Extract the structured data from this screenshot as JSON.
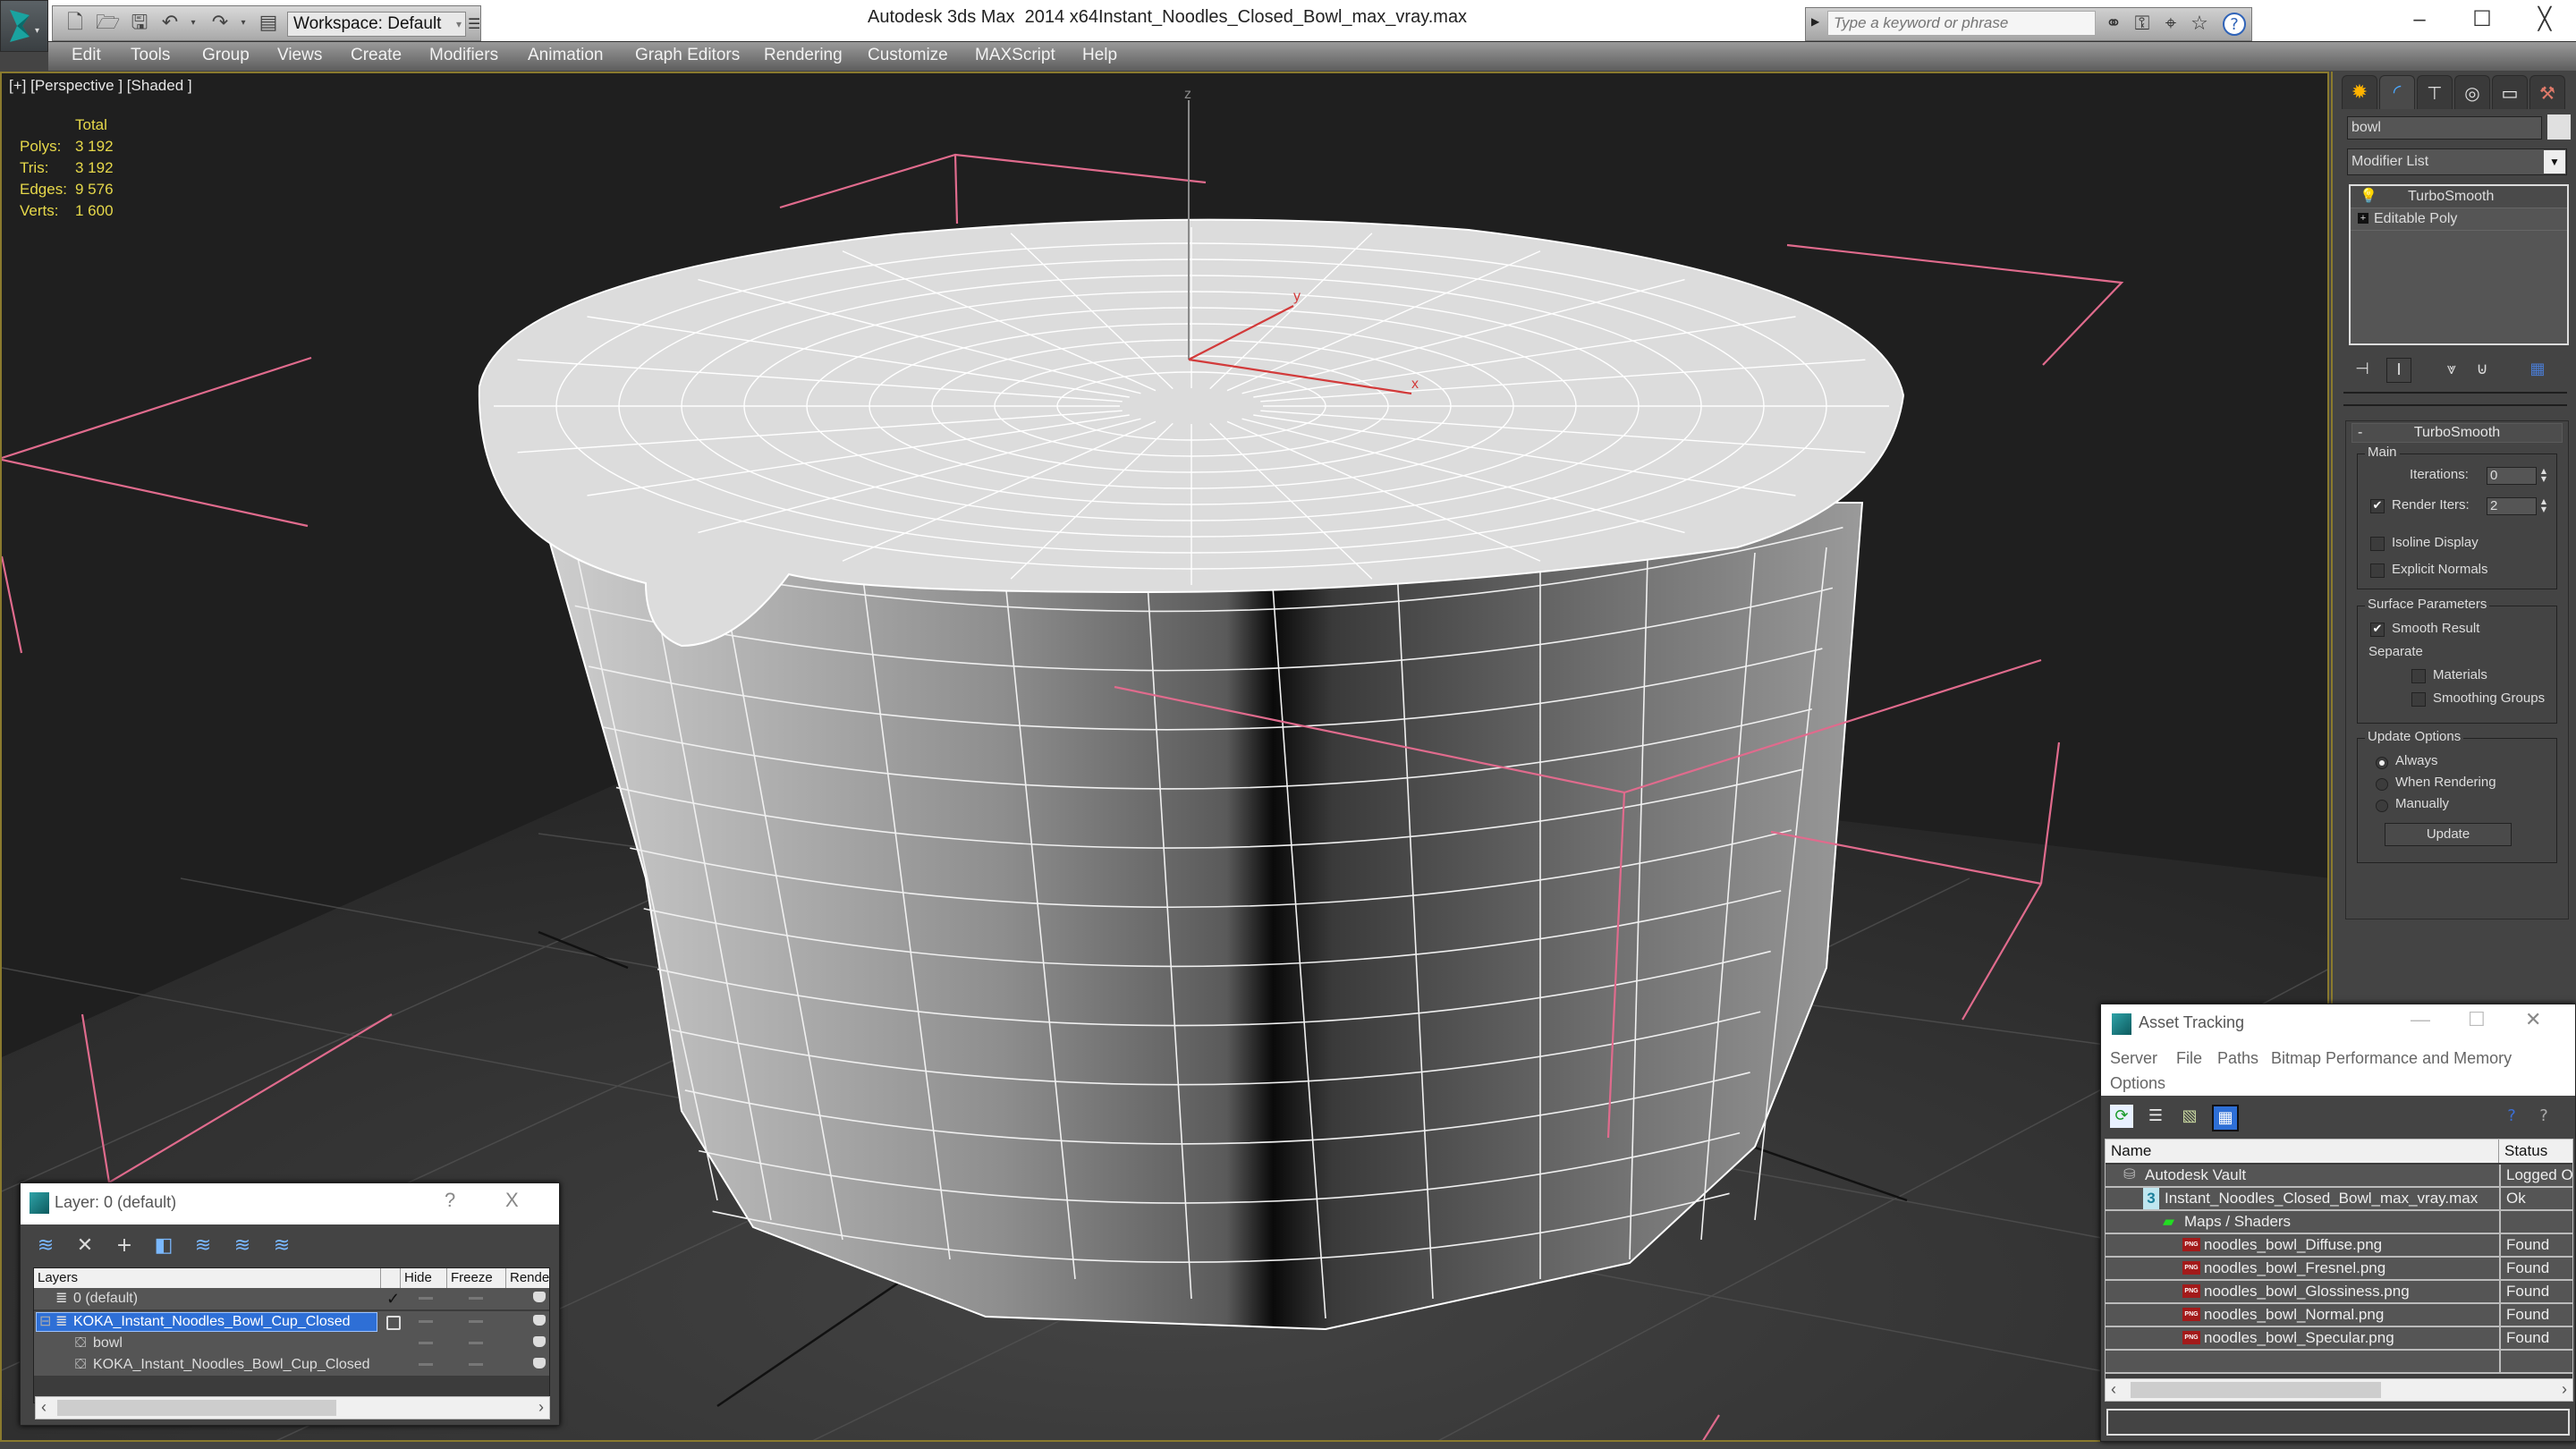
{
  "app": {
    "title": "Autodesk 3ds Max  2014 x64",
    "file_name": "Instant_Noodles_Closed_Bowl_max_vray.max",
    "workspace": "Workspace: Default",
    "search_placeholder": "Type a keyword or phrase",
    "window_controls": [
      "minimize",
      "maximize",
      "close"
    ]
  },
  "quick_access": [
    "new-file-icon",
    "open-file-icon",
    "save-icon",
    "undo-icon",
    "redo-icon",
    "project-folder-icon"
  ],
  "infocenter_icons": [
    "binoculars-icon",
    "key-icon",
    "satellite-icon",
    "star-icon",
    "help-icon"
  ],
  "menu": [
    "Edit",
    "Tools",
    "Group",
    "Views",
    "Create",
    "Modifiers",
    "Animation",
    "Graph Editors",
    "Rendering",
    "Customize",
    "MAXScript",
    "Help"
  ],
  "viewport": {
    "label": "[+] [Perspective ] [Shaded ]",
    "stats": {
      "header": "Total",
      "rows": [
        {
          "label": "Polys:",
          "value": "3 192"
        },
        {
          "label": "Tris:",
          "value": "3 192"
        },
        {
          "label": "Edges:",
          "value": "9 576"
        },
        {
          "label": "Verts:",
          "value": "1 600"
        }
      ]
    },
    "axes": {
      "x": "x",
      "y": "y",
      "z": "z"
    },
    "colors": {
      "background": "#1f1f1f",
      "grid": "#3a3a3a",
      "selection_bracket": "#e06b8d",
      "axis": "#d23a3a",
      "border": "#8a7a2e"
    }
  },
  "command_panel": {
    "tabs": [
      "create-icon",
      "modify-icon",
      "hierarchy-icon",
      "motion-icon",
      "display-icon",
      "utilities-icon"
    ],
    "object_name": "bowl",
    "modifier_list": "Modifier List",
    "stack": [
      "TurboSmooth",
      "Editable Poly"
    ],
    "turbosmooth": {
      "title": "TurboSmooth",
      "collapse": "-",
      "main_group": "Main",
      "iterations_label": "Iterations:",
      "iterations_value": "0",
      "render_iters_label": "Render Iters:",
      "render_iters_value": "2",
      "render_iters_checked": true,
      "isoline_display": "Isoline Display",
      "isoline_checked": false,
      "explicit_normals": "Explicit Normals",
      "explicit_checked": false,
      "surface_group": "Surface Parameters",
      "smooth_result": "Smooth Result",
      "smooth_result_checked": true,
      "separate": "Separate",
      "materials": "Materials",
      "materials_checked": false,
      "smoothing_groups": "Smoothing Groups",
      "smoothing_checked": false,
      "update_group": "Update Options",
      "update_options": [
        "Always",
        "When Rendering",
        "Manually"
      ],
      "update_selected": "Always",
      "update_button": "Update"
    }
  },
  "layer_dialog": {
    "title": "Layer: 0 (default)",
    "help": "?",
    "close": "X",
    "columns": [
      "Layers",
      "",
      "Hide",
      "Freeze",
      "Rende"
    ],
    "rows": [
      {
        "name": "0 (default)",
        "type": "layer",
        "current": true,
        "indent": 0
      },
      {
        "name": "KOKA_Instant_Noodles_Bowl_Cup_Closed",
        "type": "layer",
        "selected": true,
        "expanded": true,
        "indent": 0
      },
      {
        "name": "bowl",
        "type": "object",
        "indent": 1
      },
      {
        "name": "KOKA_Instant_Noodles_Bowl_Cup_Closed",
        "type": "object",
        "indent": 1
      }
    ]
  },
  "asset_dialog": {
    "title": "Asset Tracking",
    "menu": [
      "Server",
      "File",
      "Paths",
      "Bitmap Performance and Memory",
      "Options"
    ],
    "columns": [
      "Name",
      "Status"
    ],
    "rows": [
      {
        "name": "Autodesk Vault",
        "status": "Logged O",
        "icon": "vault-icon",
        "indent": 0
      },
      {
        "name": "Instant_Noodles_Closed_Bowl_max_vray.max",
        "status": "Ok",
        "icon": "max-file-icon",
        "indent": 1
      },
      {
        "name": "Maps / Shaders",
        "status": "",
        "icon": "maps-icon",
        "indent": 2
      },
      {
        "name": "noodles_bowl_Diffuse.png",
        "status": "Found",
        "icon": "png-icon",
        "indent": 3
      },
      {
        "name": "noodles_bowl_Fresnel.png",
        "status": "Found",
        "icon": "png-icon",
        "indent": 3
      },
      {
        "name": "noodles_bowl_Glossiness.png",
        "status": "Found",
        "icon": "png-icon",
        "indent": 3
      },
      {
        "name": "noodles_bowl_Normal.png",
        "status": "Found",
        "icon": "png-icon",
        "indent": 3
      },
      {
        "name": "noodles_bowl_Specular.png",
        "status": "Found",
        "icon": "png-icon",
        "indent": 3
      }
    ]
  }
}
